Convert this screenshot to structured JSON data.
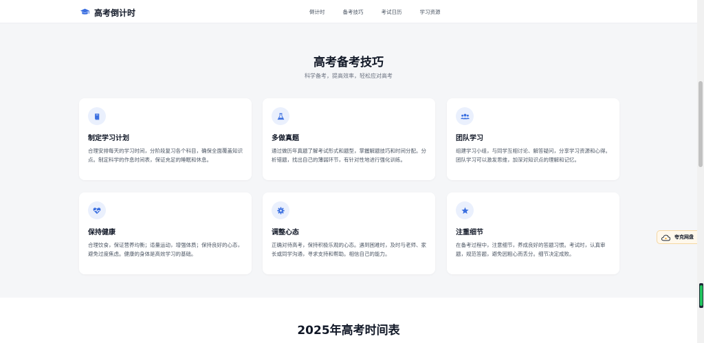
{
  "nav": {
    "brand": "高考倒计时",
    "links": [
      "倒计时",
      "备考技巧",
      "考试日历",
      "学习资源"
    ]
  },
  "tips": {
    "title": "高考备考技巧",
    "subtitle": "科学备考，提高效率，轻松应对高考",
    "cards": [
      {
        "icon": "book-icon",
        "title": "制定学习计划",
        "desc": "合理安排每天的学习时间，分阶段复习各个科目，确保全面覆盖知识点。制定科学的作息时间表，保证充足的睡眠和休息。"
      },
      {
        "icon": "flask-icon",
        "title": "多做真题",
        "desc": "通过做历年真题了解考试形式和题型，掌握解题技巧和时间分配。分析错题，找出自己的薄弱环节，有针对性地进行强化训练。"
      },
      {
        "icon": "users-icon",
        "title": "团队学习",
        "desc": "组建学习小组，与同学互相讨论、解答疑问，分享学习资源和心得。团队学习可以激发思维，加深对知识点的理解和记忆。"
      },
      {
        "icon": "heart-pulse-icon",
        "title": "保持健康",
        "desc": "合理饮食，保证营养均衡；适量运动，增强体质；保持良好的心态，避免过度焦虑。健康的身体是高效学习的基础。"
      },
      {
        "icon": "gear-icon",
        "title": "调整心态",
        "desc": "正确对待高考，保持积极乐观的心态。遇到困难时，及时与老师、家长或同学沟通，寻求支持和帮助。相信自己的能力。"
      },
      {
        "icon": "star-icon",
        "title": "注重细节",
        "desc": "在备考过程中，注意细节，养成良好的答题习惯。考试时，认真审题，规范答题，避免因粗心而丢分。细节决定成败。"
      }
    ]
  },
  "timetable": {
    "title": "2025年高考时间表"
  },
  "widget": {
    "label": "夸克网盘"
  },
  "colors": {
    "accent": "#3b6fe0",
    "icon_bg": "#eaf0fd"
  }
}
